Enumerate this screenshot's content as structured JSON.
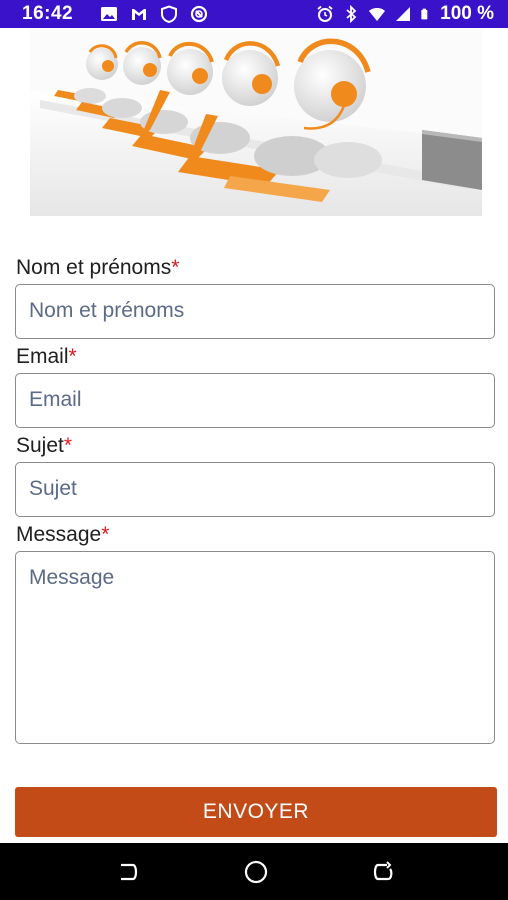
{
  "status_bar": {
    "time": "16:42",
    "battery": "100 %",
    "left_icons": [
      "image-icon",
      "gmail-icon",
      "shield-icon",
      "blocked-circle-icon"
    ],
    "right_icons": [
      "alarm-icon",
      "bluetooth-icon",
      "wifi-icon",
      "signal-icon",
      "battery-icon"
    ]
  },
  "hero": {
    "image": "call-center-agents-illustration"
  },
  "form": {
    "name": {
      "label": "Nom et prénoms",
      "required_mark": "*",
      "placeholder": "Nom et prénoms",
      "value": ""
    },
    "email": {
      "label": "Email",
      "required_mark": "*",
      "placeholder": "Email",
      "value": ""
    },
    "subject": {
      "label": "Sujet",
      "required_mark": "*",
      "placeholder": "Sujet",
      "value": ""
    },
    "message": {
      "label": "Message",
      "required_mark": "*",
      "placeholder": "Message",
      "value": ""
    },
    "submit_label": "ENVOYER"
  },
  "colors": {
    "status_bar": "#3a12c9",
    "accent_button": "#c24b18",
    "required": "#e0191e",
    "figure_orange": "#f08a1c"
  },
  "nav_bar": {
    "buttons": [
      "back-icon",
      "home-icon",
      "recents-icon"
    ]
  }
}
